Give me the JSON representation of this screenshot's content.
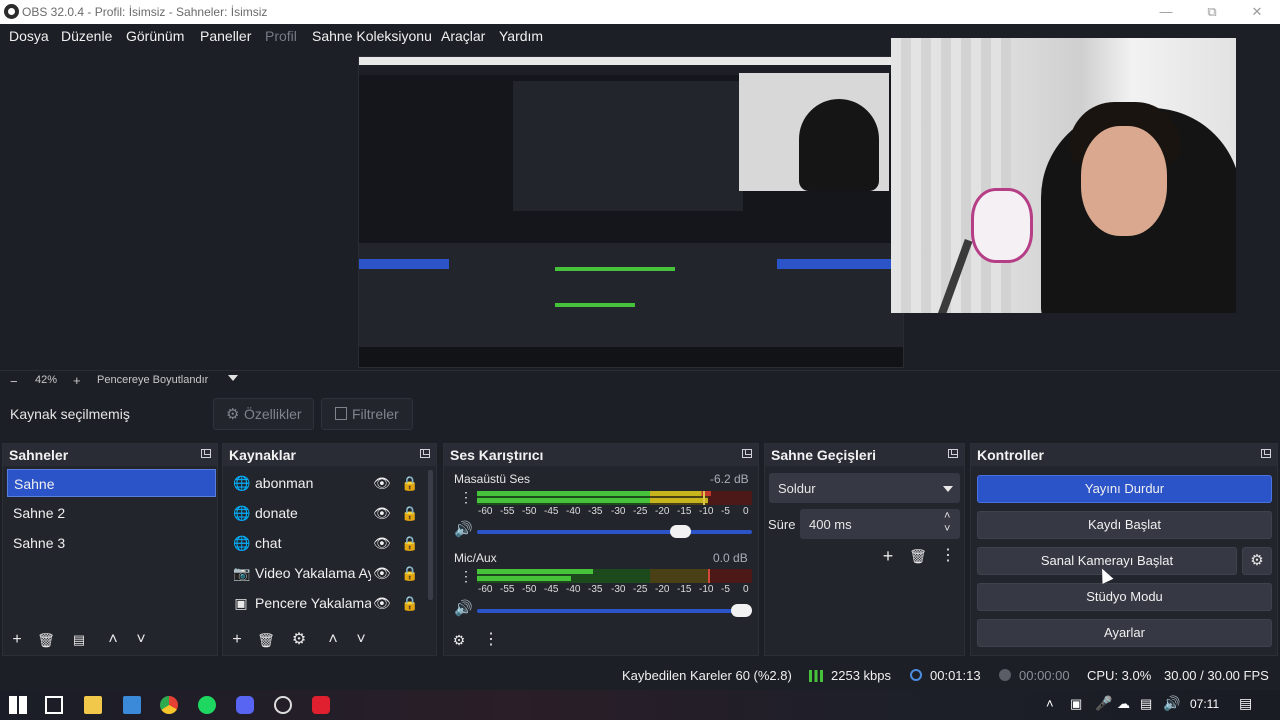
{
  "window": {
    "title": "OBS 32.0.4 - Profil: İsimsiz - Sahneler: İsimsiz"
  },
  "menu": [
    "Dosya",
    "Düzenle",
    "Görünüm",
    "Paneller",
    "Profil",
    "Sahne Koleksiyonu",
    "Araçlar",
    "Yardım"
  ],
  "zoom": {
    "minus": "−",
    "value": "42%",
    "plus": "+",
    "mode": "Pencereye Boyutlandır"
  },
  "source_toolbar": {
    "status": "Kaynak seçilmemiş",
    "properties": "Özellikler",
    "filters": "Filtreler"
  },
  "docks": {
    "scenes": {
      "title": "Sahneler",
      "items": [
        "Sahne",
        "Sahne 2",
        "Sahne 3"
      ],
      "selected": "Sahne"
    },
    "sources": {
      "title": "Kaynaklar",
      "items": [
        {
          "label": "abonman",
          "icon": "globe-icon"
        },
        {
          "label": "donate",
          "icon": "globe-icon"
        },
        {
          "label": "chat",
          "icon": "globe-icon"
        },
        {
          "label": "Video Yakalama Ay",
          "icon": "camera-icon"
        },
        {
          "label": "Pencere Yakalama",
          "icon": "window-icon"
        }
      ]
    },
    "mixer": {
      "title": "Ses Karıştırıcı",
      "channels": [
        {
          "name": "Masaüstü Ses",
          "db": "-6.2 dB",
          "level": 0.85,
          "volume": 0.76
        },
        {
          "name": "Mic/Aux",
          "db": "0.0 dB",
          "level": 0.42,
          "volume": 1.0
        }
      ],
      "scale": [
        "-60",
        "-55",
        "-50",
        "-45",
        "-40",
        "-35",
        "-30",
        "-25",
        "-20",
        "-15",
        "-10",
        "-5",
        "0"
      ]
    },
    "transitions": {
      "title": "Sahne Geçişleri",
      "transition": "Soldur",
      "duration_label": "Süre",
      "duration": "400 ms"
    },
    "controls": {
      "title": "Kontroller",
      "buttons": [
        "Yayını Durdur",
        "Kaydı Başlat",
        "Sanal Kamerayı Başlat",
        "Stüdyo Modu",
        "Ayarlar"
      ]
    }
  },
  "status": {
    "dropped": "Kaybedilen Kareler 60 (%2.8)",
    "bitrate": "2253 kbps",
    "stream_time": "00:01:13",
    "record_time": "00:00:00",
    "cpu": "CPU: 3.0%",
    "fps": "30.00 / 30.00 FPS"
  },
  "taskbar": {
    "time": "07:11"
  },
  "colors": {
    "accent": "#2c54c9",
    "background": "#1d1f26",
    "dock": "#23252d",
    "meter_green": "#46c33a",
    "meter_yellow": "#c8b51e",
    "meter_red": "#c0392b"
  }
}
